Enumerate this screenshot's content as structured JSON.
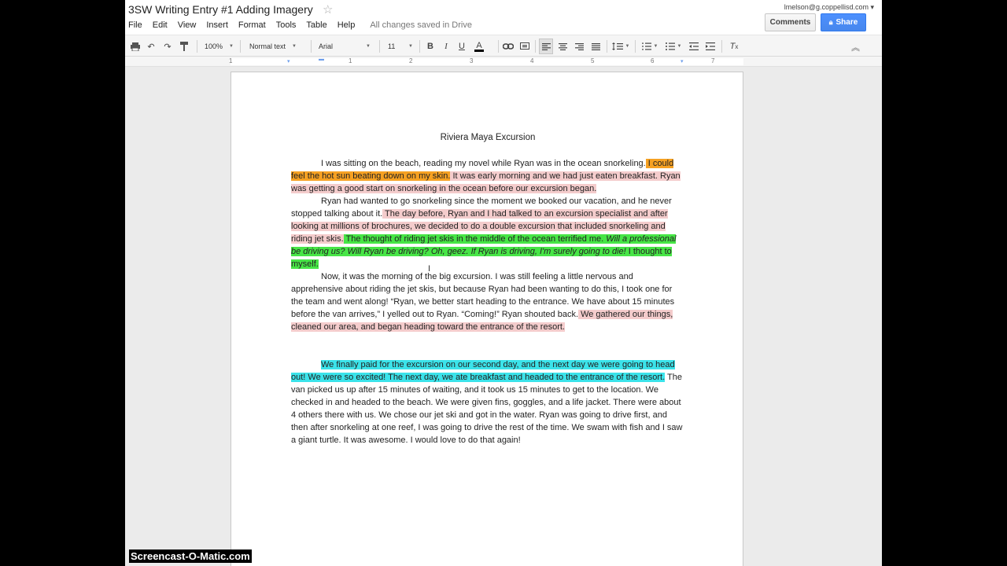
{
  "header": {
    "doc_title": "3SW Writing Entry #1 Adding Imagery",
    "account": "lmelson@g.coppellisd.com ▾",
    "comments_label": "Comments",
    "share_label": "Share",
    "save_status": "All changes saved in Drive"
  },
  "menu": [
    "File",
    "Edit",
    "View",
    "Insert",
    "Format",
    "Tools",
    "Table",
    "Help"
  ],
  "toolbar": {
    "zoom": "100%",
    "style": "Normal text",
    "font": "Arial",
    "size": "11",
    "bold": "B",
    "italic": "I",
    "underline": "U",
    "text_color": "A"
  },
  "ruler": [
    "1",
    "1",
    "2",
    "3",
    "4",
    "5",
    "6",
    "7"
  ],
  "document": {
    "heading": "Riviera Maya Excursion",
    "p1": {
      "a": "I was sitting on the beach, reading my novel while Ryan was in the ocean snorkeling.",
      "b": " I could feel the hot sun beating down on my skin.",
      "c": " It was early morning and we had just eaten breakfast. Ryan was getting a good start on snorkeling in the ocean before our excursion began."
    },
    "p2": {
      "a": "Ryan had wanted to go snorkeling since the moment we booked our vacation, and he never stopped talking about it.",
      "b": " The day before, Ryan and I had talked to an excursion specialist and after looking at millions of brochures, we decided to do a double excursion that included snorkeling and riding jet skis.",
      "c": " The thought of riding jet skis in the middle of the ocean terrified me.",
      "d": " Will a professional be driving us? Will Ryan be driving? Oh, geez. If Ryan is driving, I'm surely going to die!",
      "e": " I thought to myself."
    },
    "p3": {
      "a": "Now, it was the morning of the big excursion. I was still feeling a little nervous and apprehensive about riding the jet skis, but because Ryan had been wanting to do this, I took one for the team and went along! “Ryan, we better start heading to the entrance. We have about 15 minutes before the van arrives,” I yelled out to Ryan. “Coming!” Ryan shouted back.",
      "b": " We gathered our things, cleaned our area, and began heading toward the entrance of the resort."
    },
    "p4": {
      "a": "We finally paid for the excursion on our second day, and the next day we were going to head out! We were so excited! The next day, we ate breakfast and headed to the entrance of the resort.",
      "b": " The van picked us up after 15 minutes of waiting, and it took us 15 minutes to get to the location. We checked in and headed to the beach. We were given fins, goggles, and a life jacket. There were about 4 others there with us. We chose our jet ski and got in the water. Ryan was going to drive first, and then after snorkeling at one reef, I was going to drive the rest of the time. We swam with fish and I saw a giant turtle. It was awesome. I would love to do that again!"
    }
  },
  "highlight_colors": {
    "orange": "#f6a122",
    "pink": "#f4cccc",
    "green": "#47e546",
    "cyan": "#3be3ea"
  },
  "watermark": "Screencast-O-Matic.com"
}
